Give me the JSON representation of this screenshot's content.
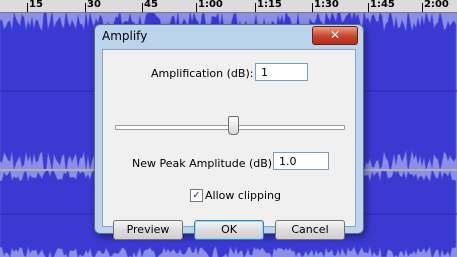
{
  "ruler": {
    "ticks": [
      "15",
      "30",
      "45",
      "1:00",
      "1:15",
      "1:30",
      "1:45",
      "2:00"
    ]
  },
  "colors": {
    "waveform": "#3a3ad3",
    "waveform_edge": "#5a5ce0",
    "track_background": "#8b8fe6",
    "dialog_frame": "#bcd3ec"
  },
  "dialog": {
    "title": "Amplify",
    "close_label": "✕",
    "amplification_label": "Amplification (dB):",
    "amplification_value": "1",
    "new_peak_label": "New Peak Amplitude (dB):",
    "new_peak_value": "1.0",
    "allow_clipping_label": "Allow clipping",
    "allow_clipping_checked": true,
    "checkmark": "✓",
    "preview_label": "Preview",
    "ok_label": "OK",
    "cancel_label": "Cancel"
  }
}
